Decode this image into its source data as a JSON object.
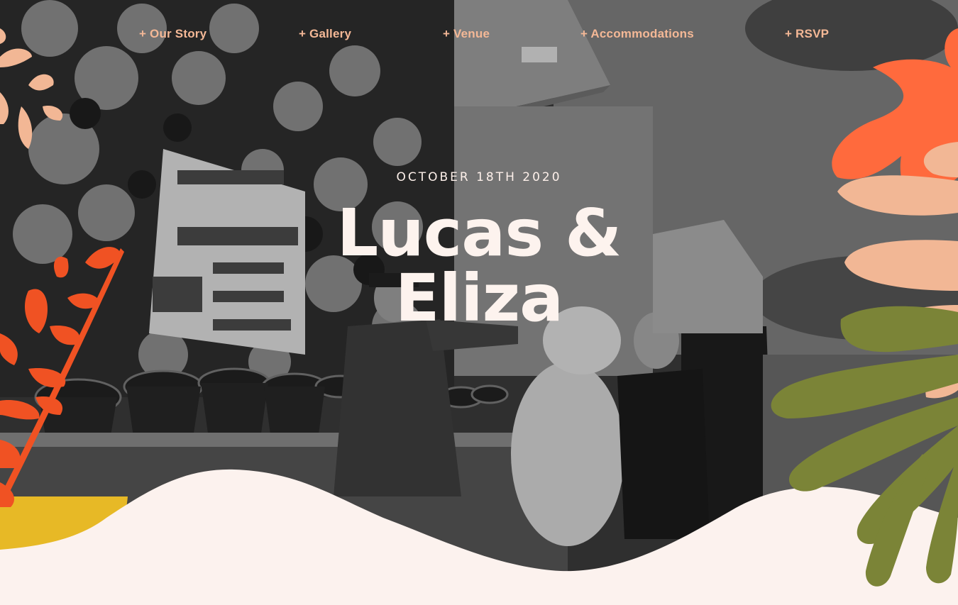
{
  "nav": {
    "items": [
      {
        "label": "+ Our Story"
      },
      {
        "label": "+ Gallery"
      },
      {
        "label": "+ Venue"
      },
      {
        "label": "+ Accommodations"
      },
      {
        "label": "+ RSVP"
      }
    ]
  },
  "hero": {
    "date": "OCTOBER 18TH 2020",
    "name_line1": "Lucas &",
    "name_line2": "Eliza"
  },
  "colors": {
    "nav_link": "#f4b896",
    "background": "#fcf2ee",
    "orange": "#ff6a3d",
    "peach": "#f2b795",
    "olive": "#7b8437",
    "red_orange": "#f05223",
    "yellow": "#e7b926"
  }
}
